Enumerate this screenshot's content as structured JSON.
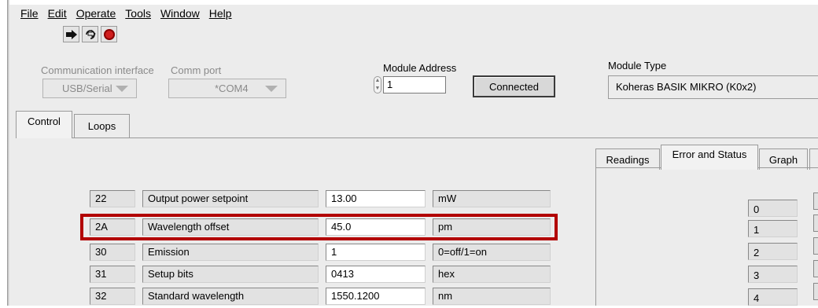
{
  "menu": {
    "items": [
      {
        "label": "File"
      },
      {
        "label": "Edit"
      },
      {
        "label": "Operate"
      },
      {
        "label": "Tools"
      },
      {
        "label": "Window"
      },
      {
        "label": "Help"
      }
    ]
  },
  "toolbar": {
    "run_icon": "run-arrow-icon",
    "run_continuous_icon": "run-continuously-icon",
    "abort_icon": "abort-stop-icon"
  },
  "comm": {
    "interface_label": "Communication interface",
    "interface_value": "USB/Serial",
    "port_label": "Comm port",
    "port_value": "*COM4"
  },
  "module": {
    "address_label": "Module Address",
    "address_value": "1",
    "connect_button": "Connected",
    "type_label": "Module Type",
    "type_value": "Koheras BASIK MIKRO (K0x2)"
  },
  "main_tabs": [
    {
      "label": "Control",
      "active": true
    },
    {
      "label": "Loops",
      "active": false
    }
  ],
  "right_tabs": [
    {
      "label": "Readings",
      "active": false
    },
    {
      "label": "Error and Status",
      "active": true
    },
    {
      "label": "Graph",
      "active": false
    }
  ],
  "registers": [
    {
      "reg": "22",
      "name": "Output power setpoint",
      "value": "13.00",
      "unit": "mW"
    },
    {
      "reg": "2A",
      "name": "Wavelength offset",
      "value": "45.0",
      "unit": "pm"
    },
    {
      "reg": "30",
      "name": "Emission",
      "value": "1",
      "unit": "0=off/1=on"
    },
    {
      "reg": "31",
      "name": "Setup bits",
      "value": "0413",
      "unit": "hex"
    },
    {
      "reg": "32",
      "name": "Standard wavelength",
      "value": "1550.1200",
      "unit": "nm"
    }
  ],
  "status_indices": [
    "0",
    "1",
    "2",
    "3",
    "4"
  ],
  "colors": {
    "highlight": "#b20000",
    "panel_bg": "#ececec"
  }
}
